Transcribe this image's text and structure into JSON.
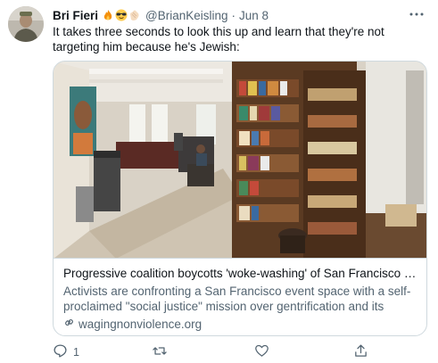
{
  "tweet": {
    "author_name": "Bri Fieri",
    "author_emojis": [
      "fire-emoji",
      "sunglasses-emoji",
      "clapping-hands-emoji"
    ],
    "handle": "@BrianKeisling",
    "separator": "·",
    "date": "Jun 8",
    "text": "It takes three seconds to look this up and learn that they're not targeting him because he's Jewish:"
  },
  "card": {
    "image": "bookstore-interior-photo",
    "title": "Progressive coalition boycotts 'woke-washing' of San Francisco event s...",
    "description": "Activists are confronting a San Francisco event space with a self-proclaimed \"social justice\" mission over gentrification and its owner's ...",
    "domain": "wagingnonviolence.org"
  },
  "actions": {
    "reply_count": "1",
    "retweet_count": "",
    "like_count": "",
    "share_label": ""
  },
  "icons": {
    "more": "more-dots-icon",
    "reply": "reply-icon",
    "retweet": "retweet-icon",
    "like": "heart-icon",
    "share": "share-icon",
    "link": "link-icon"
  },
  "colors": {
    "text_primary": "#0f1419",
    "text_secondary": "#536471",
    "border": "#cfd9de"
  }
}
